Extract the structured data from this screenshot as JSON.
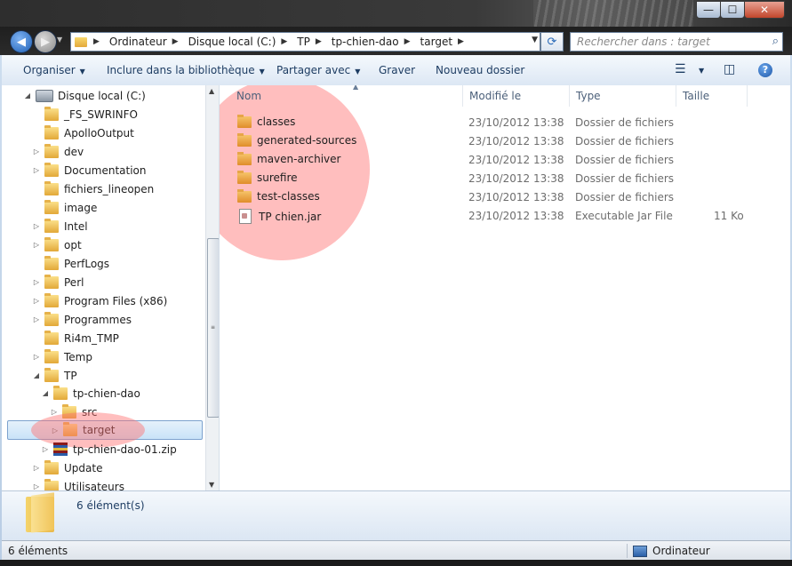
{
  "window": {
    "controls": {
      "minimize": "—",
      "maximize": "☐",
      "close": "✕"
    }
  },
  "addressbar": {
    "breadcrumbs": [
      "Ordinateur",
      "Disque local (C:)",
      "TP",
      "tp-chien-dao",
      "target"
    ],
    "search_placeholder": "Rechercher dans : target"
  },
  "toolbar": {
    "organize": "Organiser",
    "include": "Inclure dans la bibliothèque",
    "share": "Partager avec",
    "burn": "Graver",
    "new_folder": "Nouveau dossier"
  },
  "tree": {
    "drive": "Disque local (C:)",
    "items": [
      {
        "label": "_FS_SWRINFO",
        "expander": false
      },
      {
        "label": "ApolloOutput",
        "expander": false
      },
      {
        "label": "dev",
        "expander": true
      },
      {
        "label": "Documentation",
        "expander": true
      },
      {
        "label": "fichiers_lineopen",
        "expander": false
      },
      {
        "label": "image",
        "expander": false
      },
      {
        "label": "Intel",
        "expander": true
      },
      {
        "label": "opt",
        "expander": true
      },
      {
        "label": "PerfLogs",
        "expander": false
      },
      {
        "label": "Perl",
        "expander": true
      },
      {
        "label": "Program Files (x86)",
        "expander": true
      },
      {
        "label": "Programmes",
        "expander": true
      },
      {
        "label": "Ri4m_TMP",
        "expander": false
      },
      {
        "label": "Temp",
        "expander": true
      },
      {
        "label": "TP",
        "expander": "open"
      }
    ],
    "tp_child": "tp-chien-dao",
    "tp_grandchildren": [
      "src",
      "target"
    ],
    "zip": "tp-chien-dao-01.zip",
    "after": [
      "Update",
      "Utilisateurs"
    ]
  },
  "columns": {
    "name": "Nom",
    "modified": "Modifié le",
    "type": "Type",
    "size": "Taille"
  },
  "files": [
    {
      "name": "classes",
      "date": "23/10/2012 13:38",
      "type": "Dossier de fichiers",
      "size": "",
      "kind": "folder"
    },
    {
      "name": "generated-sources",
      "date": "23/10/2012 13:38",
      "type": "Dossier de fichiers",
      "size": "",
      "kind": "folder"
    },
    {
      "name": "maven-archiver",
      "date": "23/10/2012 13:38",
      "type": "Dossier de fichiers",
      "size": "",
      "kind": "folder"
    },
    {
      "name": "surefire",
      "date": "23/10/2012 13:38",
      "type": "Dossier de fichiers",
      "size": "",
      "kind": "folder"
    },
    {
      "name": "test-classes",
      "date": "23/10/2012 13:38",
      "type": "Dossier de fichiers",
      "size": "",
      "kind": "folder"
    },
    {
      "name": "TP chien.jar",
      "date": "23/10/2012 13:38",
      "type": "Executable Jar File",
      "size": "11 Ko",
      "kind": "jar"
    }
  ],
  "details": {
    "count": "6 élément(s)"
  },
  "status": {
    "left": "6 éléments",
    "right": "Ordinateur"
  },
  "colors": {
    "highlight": "#ff6e6e",
    "selection": "#c9e3f8",
    "link_text": "#1e3d63"
  }
}
